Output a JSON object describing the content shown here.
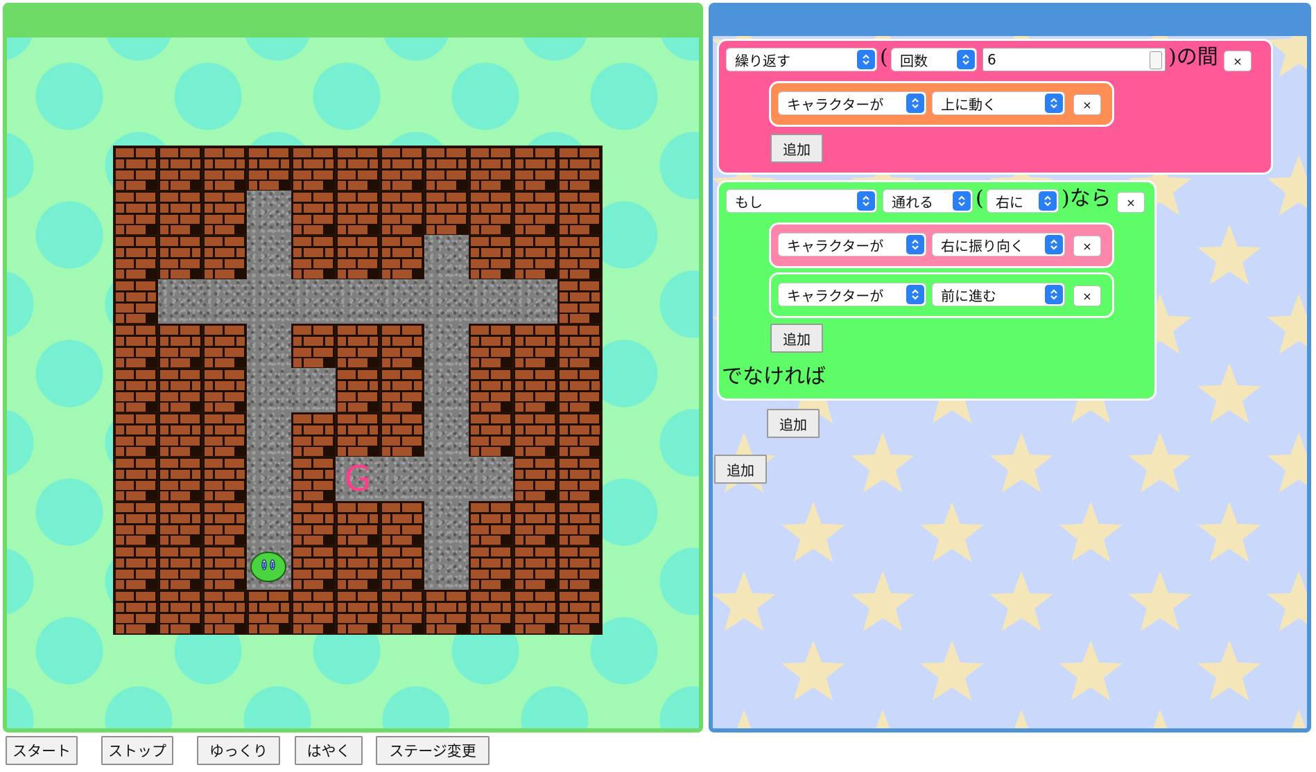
{
  "maze": {
    "rows": [
      "WWWWWWWWWWW",
      "WWWPWWWWWWW",
      "WWWPWWWPWWW",
      "WPPPPPPPPPW",
      "WWWPWWWPWWW",
      "WWWPPWWPWWW",
      "WWWPWWWPWWW",
      "WWWPWPPPPWW",
      "WWWPWWWPWWW",
      "WWWPWWWPWWW",
      "WWWWWWWWWWW"
    ],
    "goal": {
      "row": 7,
      "col": 5,
      "label": "G"
    },
    "character": {
      "row": 9,
      "col": 3
    }
  },
  "controls": {
    "start": "スタート",
    "stop": "ストップ",
    "slow": "ゆっくり",
    "fast": "はやく",
    "stage_change": "ステージ変更"
  },
  "program": {
    "repeat_block": {
      "type_value": "繰り返す",
      "mode_value": "回数",
      "count_value": "6",
      "open_paren": "(",
      "suffix": ")の間",
      "close_label": "×",
      "inner": [
        {
          "subject": "キャラクターが",
          "action": "上に動く",
          "close_label": "×"
        }
      ],
      "add_label": "追加"
    },
    "if_block": {
      "type_value": "もし",
      "condition_value": "通れる",
      "open_paren": "(",
      "direction_value": "右に",
      "suffix": ")なら",
      "close_label": "×",
      "then": [
        {
          "subject": "キャラクターが",
          "action": "右に振り向く",
          "close_label": "×"
        },
        {
          "subject": "キャラクターが",
          "action": "前に進む",
          "close_label": "×"
        }
      ],
      "then_add_label": "追加",
      "else_label": "でなければ",
      "else_add_label": "追加"
    },
    "root_add_label": "追加"
  },
  "colors": {
    "game_border": "#6fdb67",
    "code_border": "#4d93d9",
    "repeat_block": "#ff5a98",
    "repeat_inner": "#ff8e55",
    "if_block": "#5efc67",
    "if_inner_pink": "#ff86ab",
    "star": "#f5e6b9",
    "select_arrow": "#2a7ff5"
  }
}
